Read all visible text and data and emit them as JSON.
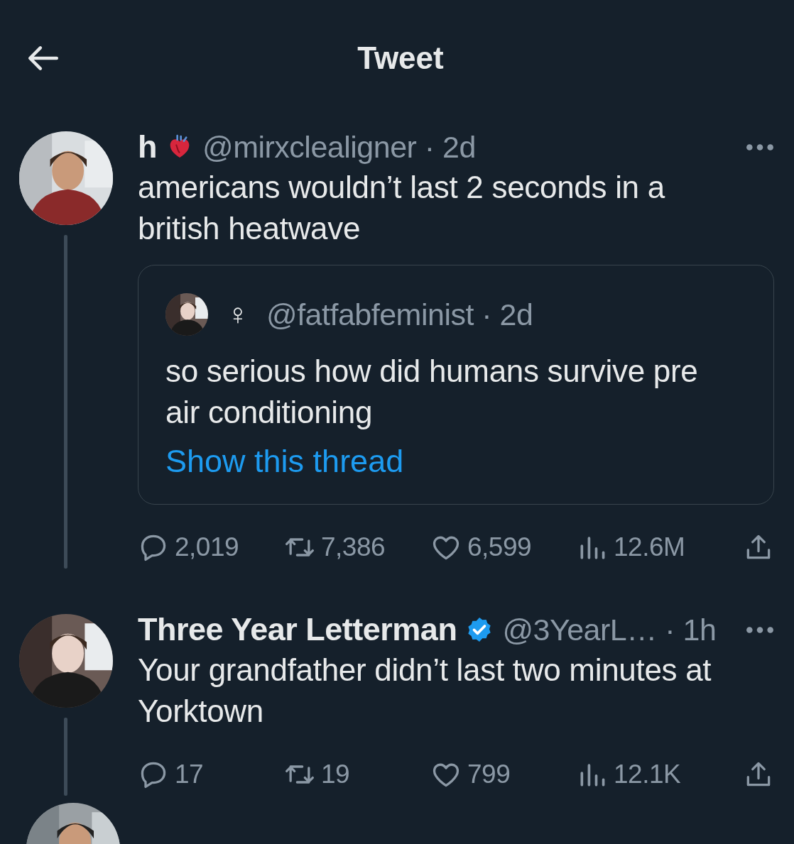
{
  "header": {
    "title": "Tweet"
  },
  "tweets": [
    {
      "name": "h",
      "heart_emoji": true,
      "verified": false,
      "meta": "@mirxclealigner · 2d",
      "text": "americans wouldn’t last 2 seconds in a british heatwave",
      "thread_continues": true,
      "quote": {
        "symbol": "♀",
        "meta": "@fatfabfeminist · 2d",
        "text": "so serious how did humans survive pre air conditioning",
        "link": "Show this thread"
      },
      "stats": [
        {
          "kind": "reply",
          "count": "2,019"
        },
        {
          "kind": "retweet",
          "count": "7,386"
        },
        {
          "kind": "like",
          "count": "6,599"
        },
        {
          "kind": "views",
          "count": "12.6M"
        },
        {
          "kind": "share"
        }
      ]
    },
    {
      "name": "Three Year Letterman",
      "heart_emoji": false,
      "verified": true,
      "meta": "@3YearL… · 1h",
      "text": "Your grandfather didn’t last two minutes at Yorktown",
      "thread_continues": true,
      "stats": [
        {
          "kind": "reply",
          "count": "17"
        },
        {
          "kind": "retweet",
          "count": "19"
        },
        {
          "kind": "like",
          "count": "799"
        },
        {
          "kind": "views",
          "count": "12.1K"
        },
        {
          "kind": "share"
        }
      ]
    }
  ]
}
